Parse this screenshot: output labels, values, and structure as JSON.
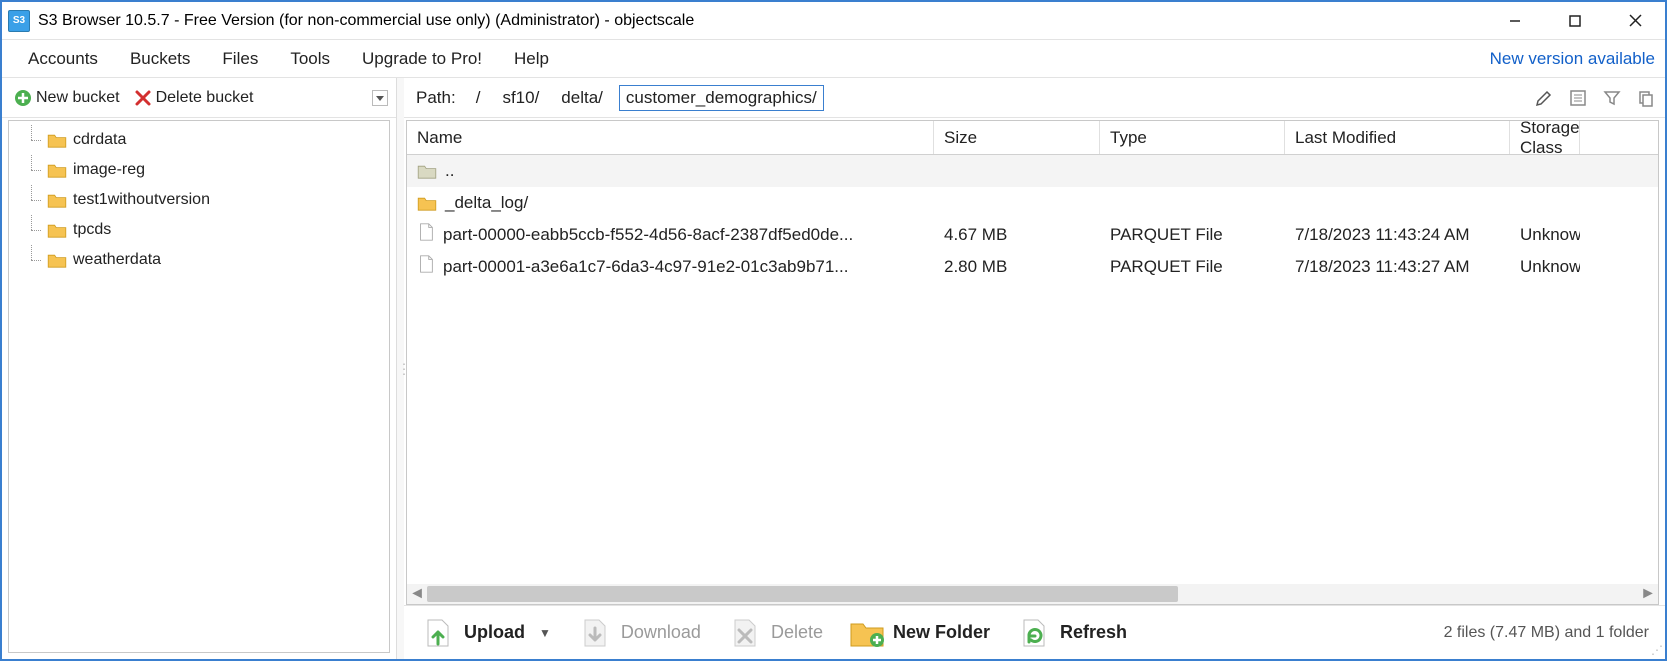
{
  "titlebar": {
    "title": "S3 Browser 10.5.7 - Free Version (for non-commercial use only) (Administrator) - objectscale"
  },
  "menubar": {
    "items": [
      "Accounts",
      "Buckets",
      "Files",
      "Tools",
      "Upgrade to Pro!",
      "Help"
    ],
    "notice": "New version available"
  },
  "bucket_toolbar": {
    "new_bucket": "New bucket",
    "delete_bucket": "Delete bucket"
  },
  "buckets": [
    "cdrdata",
    "image-reg",
    "test1withoutversion",
    "tpcds",
    "weatherdata"
  ],
  "path": {
    "label": "Path:",
    "root": "/",
    "segments": [
      "sf10/",
      "delta/"
    ],
    "current": "customer_demographics/"
  },
  "columns": {
    "name": "Name",
    "size": "Size",
    "type": "Type",
    "modified": "Last Modified",
    "storage": "Storage Class"
  },
  "rows": [
    {
      "kind": "up",
      "name": "..",
      "size": "",
      "type": "",
      "modified": "",
      "storage": ""
    },
    {
      "kind": "folder",
      "name": "_delta_log/",
      "size": "",
      "type": "",
      "modified": "",
      "storage": ""
    },
    {
      "kind": "file",
      "name": "part-00000-eabb5ccb-f552-4d56-8acf-2387df5ed0de...",
      "size": "4.67 MB",
      "type": "PARQUET File",
      "modified": "7/18/2023 11:43:24 AM",
      "storage": "Unknown"
    },
    {
      "kind": "file",
      "name": "part-00001-a3e6a1c7-6da3-4c97-91e2-01c3ab9b71...",
      "size": "2.80 MB",
      "type": "PARQUET File",
      "modified": "7/18/2023 11:43:27 AM",
      "storage": "Unknown"
    }
  ],
  "bottom": {
    "upload": "Upload",
    "download": "Download",
    "delete": "Delete",
    "new_folder": "New Folder",
    "refresh": "Refresh"
  },
  "status": "2 files (7.47 MB) and 1 folder"
}
